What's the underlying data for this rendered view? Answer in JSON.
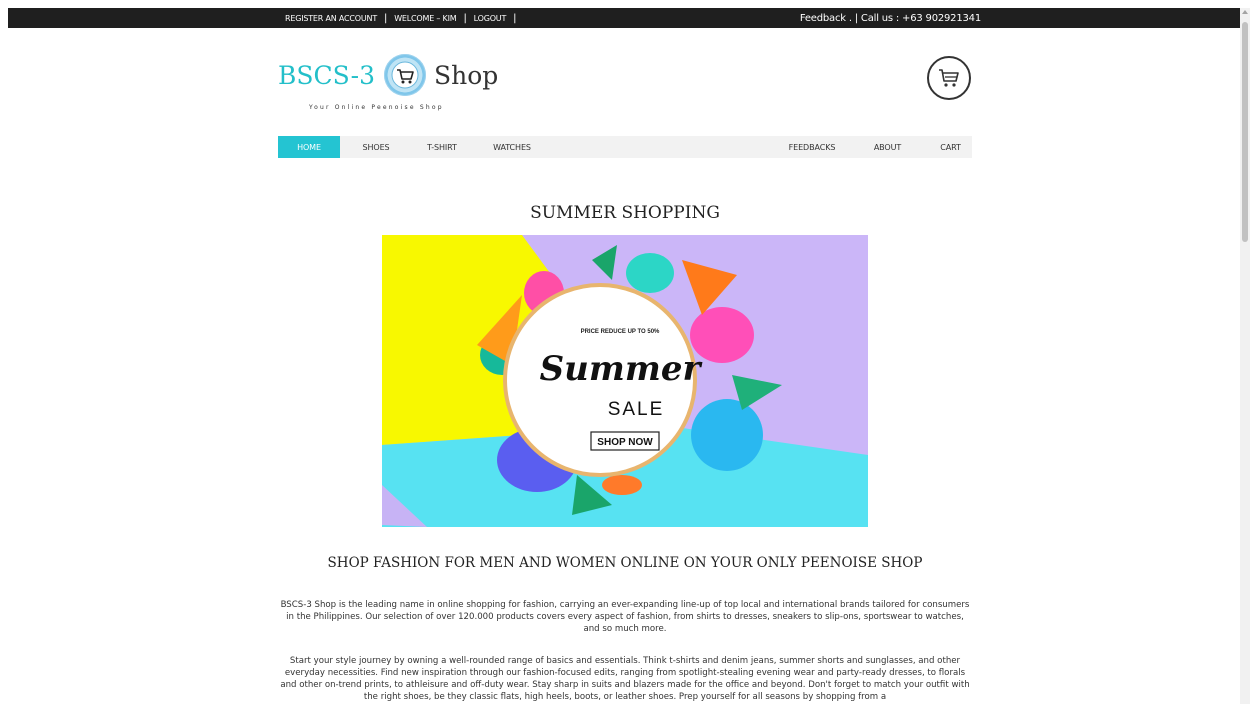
{
  "topbar": {
    "links": [
      "REGISTER AN ACCOUNT",
      "WELCOME – KIM",
      "LOGOUT"
    ],
    "contact": "Feedback . | Call us : +63 902921341"
  },
  "brand": {
    "name_left": "BSCS-3",
    "name_right": "Shop",
    "tagline": "Your Online Peenoise Shop"
  },
  "nav": {
    "items": [
      "HOME",
      "SHOES",
      "T-SHIRT",
      "WATCHES",
      "FEEDBACKS",
      "ABOUT",
      "CART"
    ]
  },
  "hero": {
    "title": "SUMMER SHOPPING",
    "banner": {
      "tagline": "PRICE REDUCE UP TO 50%",
      "headline": "Summer",
      "subheadline": "SALE",
      "button": "SHOP NOW"
    }
  },
  "content": {
    "heading": "SHOP FASHION FOR MEN AND WOMEN ONLINE ON YOUR ONLY PEENOISE SHOP",
    "paragraph1": "BSCS-3 Shop is the leading name in online shopping for fashion, carrying an ever-expanding line-up of top local and international brands tailored for consumers in the Philippines. Our selection of over 120.000 products covers every aspect of fashion, from shirts to dresses, sneakers to slip-ons, sportswear to watches, and so much more.",
    "paragraph2": "Start your style journey by owning a well-rounded range of basics and essentials. Think t-shirts and denim jeans, summer shorts and sunglasses, and other everyday necessities. Find new inspiration through our fashion-focused edits, ranging from spotlight-stealing evening wear and party-ready dresses, to florals and other on-trend prints, to athleisure and off-duty wear. Stay sharp in suits and blazers made for the office and beyond. Don't forget to match your outfit with the right shoes, be they classic flats, high heels, boots, or leather shoes. Prep yourself for all seasons by shopping from a"
  },
  "colors": {
    "accent": "#24c4d2",
    "topbar": "#1f1f1f",
    "nav_bg": "#f2f2f2"
  },
  "icons": [
    "cart-icon",
    "logo-icon"
  ]
}
